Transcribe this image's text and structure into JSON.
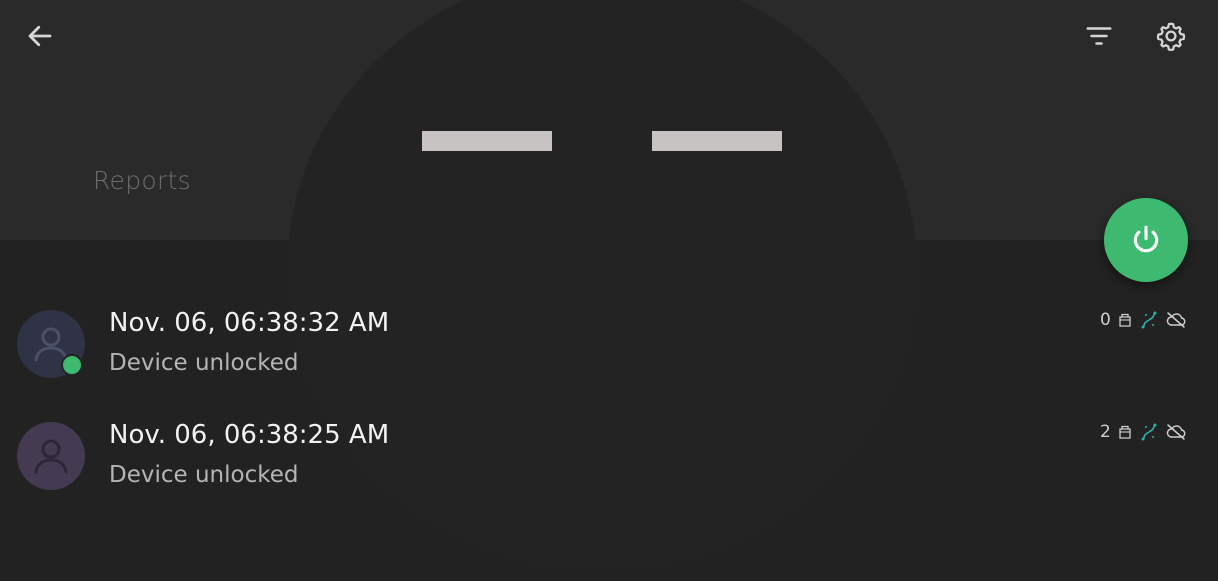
{
  "header": {
    "section_label": "Reports"
  },
  "icons": {
    "back": "arrow-left-icon",
    "filter": "filter-icon",
    "settings": "gear-icon",
    "power": "power-icon",
    "avatar": "user-icon",
    "box": "box-icon",
    "connection": "connection-icon",
    "cloud_off": "cloud-off-icon"
  },
  "colors": {
    "accent_green": "#3dba6f",
    "teal": "#2ab3a3",
    "background": "#222222",
    "header_bg": "#2a2a2a"
  },
  "events": [
    {
      "datetime": "Nov. 06, 06:38:32 AM",
      "description": "Device unlocked",
      "count": "0"
    },
    {
      "datetime": "Nov. 06, 06:38:25 AM",
      "description": "Device unlocked",
      "count": "2"
    }
  ]
}
